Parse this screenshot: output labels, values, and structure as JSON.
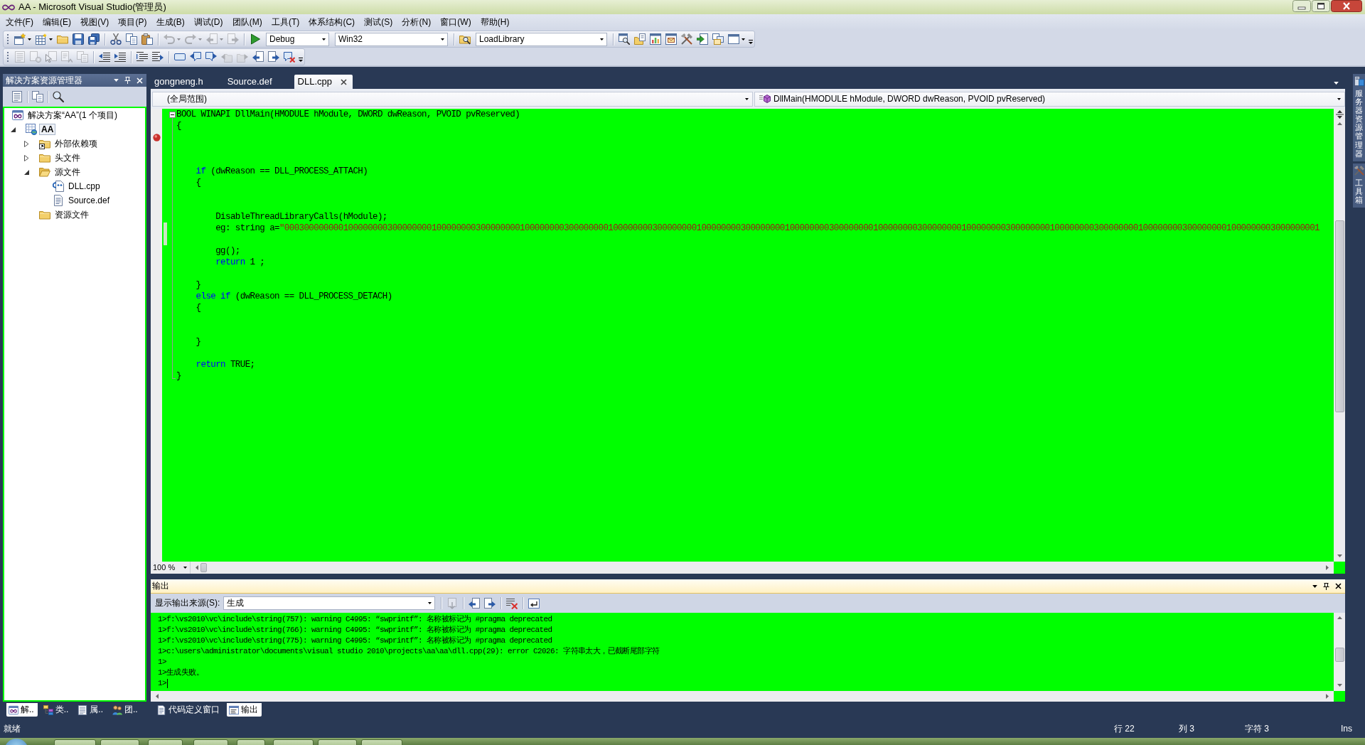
{
  "window": {
    "title": "AA - Microsoft Visual Studio(管理员)"
  },
  "menu": [
    "文件(F)",
    "编辑(E)",
    "视图(V)",
    "项目(P)",
    "生成(B)",
    "调试(D)",
    "团队(M)",
    "工具(T)",
    "体系结构(C)",
    "测试(S)",
    "分析(N)",
    "窗口(W)",
    "帮助(H)"
  ],
  "toolbars": [
    {
      "items": [
        {
          "kind": "split",
          "disabled": false
        },
        {
          "kind": "split",
          "disabled": false
        },
        {
          "kind": "button",
          "disabled": false
        },
        {
          "kind": "button",
          "disabled": false
        },
        {
          "kind": "button",
          "disabled": false
        },
        {
          "kind": "separator"
        },
        {
          "kind": "button",
          "disabled": false
        },
        {
          "kind": "button",
          "disabled": false
        },
        {
          "kind": "button",
          "disabled": false
        },
        {
          "kind": "separator"
        },
        {
          "kind": "split",
          "disabled": true
        },
        {
          "kind": "split",
          "disabled": true
        },
        {
          "kind": "split",
          "disabled": true
        },
        {
          "kind": "button",
          "disabled": true
        },
        {
          "kind": "separator"
        },
        {
          "kind": "button",
          "disabled": false
        },
        {
          "kind": "combo",
          "value": "Debug"
        },
        {
          "kind": "combo",
          "value": "Win32"
        },
        {
          "kind": "separator"
        },
        {
          "kind": "button",
          "disabled": false
        },
        {
          "kind": "combo",
          "value": "LoadLibrary"
        },
        {
          "kind": "separator"
        },
        {
          "kind": "button",
          "disabled": false
        },
        {
          "kind": "button",
          "disabled": false
        },
        {
          "kind": "button",
          "disabled": false
        },
        {
          "kind": "button",
          "disabled": false
        },
        {
          "kind": "button",
          "disabled": false
        },
        {
          "kind": "button",
          "disabled": false
        },
        {
          "kind": "button",
          "disabled": false
        },
        {
          "kind": "split",
          "disabled": false
        }
      ]
    },
    {
      "items": [
        {
          "kind": "button",
          "disabled": true
        },
        {
          "kind": "button",
          "disabled": true
        },
        {
          "kind": "button",
          "disabled": true
        },
        {
          "kind": "button",
          "disabled": true
        },
        {
          "kind": "button",
          "disabled": true
        },
        {
          "kind": "separator"
        },
        {
          "kind": "button",
          "disabled": false
        },
        {
          "kind": "button",
          "disabled": false
        },
        {
          "kind": "separator"
        },
        {
          "kind": "button",
          "disabled": false
        },
        {
          "kind": "button",
          "disabled": false
        },
        {
          "kind": "separator"
        },
        {
          "kind": "button",
          "disabled": false
        },
        {
          "kind": "button",
          "disabled": false
        },
        {
          "kind": "button",
          "disabled": false
        },
        {
          "kind": "button",
          "disabled": true
        },
        {
          "kind": "button",
          "disabled": true
        },
        {
          "kind": "button",
          "disabled": false
        },
        {
          "kind": "button",
          "disabled": false
        },
        {
          "kind": "button",
          "disabled": false
        }
      ]
    }
  ],
  "solution_explorer": {
    "title": "解决方案资源管理器",
    "tree": [
      {
        "kind": "solution",
        "label": "解决方案“AA”(1 个项目)",
        "selected": false,
        "children": [
          {
            "kind": "project",
            "label": "AA",
            "selected": true,
            "expanded": true,
            "children": [
              {
                "kind": "references",
                "label": "外部依赖项",
                "selected": false,
                "expanded": false
              },
              {
                "kind": "folder",
                "label": "头文件",
                "selected": false,
                "expanded": false
              },
              {
                "kind": "folder",
                "label": "源文件",
                "selected": false,
                "expanded": true,
                "children": [
                  {
                    "kind": "cpp",
                    "label": "DLL.cpp",
                    "selected": false
                  },
                  {
                    "kind": "def",
                    "label": "Source.def",
                    "selected": false
                  }
                ]
              },
              {
                "kind": "folder",
                "label": "资源文件",
                "selected": false
              }
            ]
          }
        ]
      }
    ]
  },
  "left_tabs": [
    {
      "label": "解..",
      "selected": true
    },
    {
      "label": "类..",
      "selected": false
    },
    {
      "label": "属..",
      "selected": false
    },
    {
      "label": "团..",
      "selected": false
    }
  ],
  "editor": {
    "tabs": [
      {
        "label": "gongneng.h",
        "selected": false
      },
      {
        "label": "Source.def",
        "selected": false
      },
      {
        "label": "DLL.cpp",
        "selected": true
      }
    ],
    "scope": "(全局范围)",
    "member": "DllMain(HMODULE hModule, DWORD dwReason, PVOID pvReserved)",
    "fold": {
      "expanded": true
    },
    "lines": [
      {
        "kind": "code",
        "tokens": [
          {
            "kind": "plain",
            "text": "BOOL WINAPI DllMain(HMODULE hModule, DWORD dwReason, PVOID pvReserved)"
          }
        ],
        "breakpoint": false,
        "changed": false
      },
      {
        "kind": "code",
        "tokens": [
          {
            "kind": "plain",
            "text": "{"
          }
        ],
        "breakpoint": false,
        "changed": false
      },
      {
        "kind": "blank",
        "breakpoint": true,
        "changed": false
      },
      {
        "kind": "blank",
        "breakpoint": false,
        "changed": false
      },
      {
        "kind": "blank",
        "breakpoint": false,
        "changed": false
      },
      {
        "kind": "code",
        "tokens": [
          {
            "kind": "keyword",
            "text": "    if"
          },
          {
            "kind": "plain",
            "text": " (dwReason == DLL_PROCESS_ATTACH)"
          }
        ],
        "breakpoint": false,
        "changed": false
      },
      {
        "kind": "code",
        "tokens": [
          {
            "kind": "plain",
            "text": "    {"
          }
        ],
        "breakpoint": false,
        "changed": false
      },
      {
        "kind": "blank",
        "breakpoint": false,
        "changed": false
      },
      {
        "kind": "blank",
        "breakpoint": false,
        "changed": false
      },
      {
        "kind": "code",
        "tokens": [
          {
            "kind": "plain",
            "text": "        DisableThreadLibraryCalls(hModule);"
          }
        ],
        "breakpoint": false,
        "changed": false
      },
      {
        "kind": "code",
        "tokens": [
          {
            "kind": "plain",
            "text": "        eg: string a="
          },
          {
            "kind": "string",
            "text": "\"0003000000001000000003000000001000000003000000001000000003000000001000000003000000001000000003000000001000000003000000001000000003000000001000000003000000001000000003000000001000000003000000001000000003000000001"
          }
        ],
        "breakpoint": false,
        "changed": true
      },
      {
        "kind": "blank",
        "breakpoint": false,
        "changed": true
      },
      {
        "kind": "code",
        "tokens": [
          {
            "kind": "plain",
            "text": "        gg();"
          }
        ],
        "breakpoint": false,
        "changed": false
      },
      {
        "kind": "code",
        "tokens": [
          {
            "kind": "keyword",
            "text": "        return"
          },
          {
            "kind": "plain",
            "text": " 1 ;"
          }
        ],
        "breakpoint": false,
        "changed": false
      },
      {
        "kind": "blank",
        "breakpoint": false,
        "changed": false
      },
      {
        "kind": "code",
        "tokens": [
          {
            "kind": "plain",
            "text": "    }"
          }
        ],
        "breakpoint": false,
        "changed": false
      },
      {
        "kind": "code",
        "tokens": [
          {
            "kind": "keyword",
            "text": "    else if"
          },
          {
            "kind": "plain",
            "text": " (dwReason == DLL_PROCESS_DETACH)"
          }
        ],
        "breakpoint": false,
        "changed": false
      },
      {
        "kind": "code",
        "tokens": [
          {
            "kind": "plain",
            "text": "    {"
          }
        ],
        "breakpoint": false,
        "changed": false
      },
      {
        "kind": "blank",
        "breakpoint": false,
        "changed": false
      },
      {
        "kind": "blank",
        "breakpoint": false,
        "changed": false
      },
      {
        "kind": "code",
        "tokens": [
          {
            "kind": "plain",
            "text": "    }"
          }
        ],
        "breakpoint": false,
        "changed": false
      },
      {
        "kind": "blank",
        "breakpoint": false,
        "changed": false
      },
      {
        "kind": "code",
        "tokens": [
          {
            "kind": "keyword",
            "text": "    return"
          },
          {
            "kind": "plain",
            "text": " TRUE;"
          }
        ],
        "breakpoint": false,
        "changed": false
      },
      {
        "kind": "code",
        "tokens": [
          {
            "kind": "plain",
            "text": "}"
          }
        ],
        "breakpoint": false,
        "changed": false
      }
    ],
    "zoom": "100 %"
  },
  "output": {
    "title": "输出",
    "source_label": "显示输出来源(S):",
    "source": "生成",
    "toolbar": [
      {
        "kind": "separator"
      },
      {
        "kind": "button",
        "disabled": true
      },
      {
        "kind": "separator"
      },
      {
        "kind": "button",
        "disabled": false
      },
      {
        "kind": "button",
        "disabled": false
      },
      {
        "kind": "separator"
      },
      {
        "kind": "button",
        "disabled": false
      },
      {
        "kind": "separator"
      },
      {
        "kind": "button",
        "disabled": false
      }
    ],
    "lines": [
      {
        "text": "1>f:\\vs2010\\vc\\include\\string(757): warning C4995: “swprintf”: 名称被标记为 #pragma deprecated",
        "cursor": false
      },
      {
        "text": "1>f:\\vs2010\\vc\\include\\string(766): warning C4995: “swprintf”: 名称被标记为 #pragma deprecated",
        "cursor": false
      },
      {
        "text": "1>f:\\vs2010\\vc\\include\\string(775): warning C4995: “swprintf”: 名称被标记为 #pragma deprecated",
        "cursor": false
      },
      {
        "text": "1>c:\\users\\administrator\\documents\\visual studio 2010\\projects\\aa\\aa\\dll.cpp(29): error C2026: 字符串太大，已截断尾部字符",
        "cursor": false
      },
      {
        "text": "1>",
        "cursor": false
      },
      {
        "text": "1>生成失败。",
        "cursor": false
      },
      {
        "text": "1>",
        "cursor": true
      }
    ]
  },
  "bottom_tabs": [
    {
      "label": "代码定义窗口",
      "selected": false
    },
    {
      "label": "输出",
      "selected": true
    }
  ],
  "side_tabs": [
    {
      "label": "服务器资源管理器"
    },
    {
      "label": "工具箱"
    }
  ],
  "status_bar": {
    "message": "就绪",
    "line": "行 22",
    "column": "列 3",
    "char": "字符 3",
    "mode": "Ins"
  }
}
